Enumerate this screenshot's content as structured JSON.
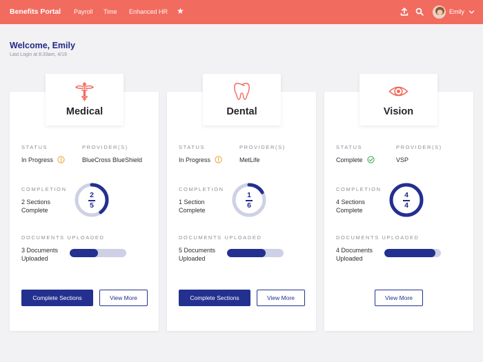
{
  "header": {
    "brand": "Benefits Portal",
    "nav": [
      "Payroll",
      "Time",
      "Enhanced HR"
    ],
    "icons": [
      "star-icon",
      "upload-icon",
      "search-icon"
    ],
    "user_name": "Emily",
    "colors": {
      "bar": "#f26b5f",
      "text": "#ffffff"
    }
  },
  "welcome": {
    "title": "Welcome, Emily",
    "last_login": "Last Login at 8:33am, 4/19"
  },
  "labels": {
    "status": "STATUS",
    "providers": "PROVIDER(S)",
    "completion": "COMPLETION",
    "documents": "DOCUMENTS UPLOADED"
  },
  "colors": {
    "accent": "#23308f",
    "ring_track": "#ced1e6",
    "in_progress": "#f0a43c",
    "complete": "#3fae5a",
    "icon": "#f26b5f"
  },
  "cards": [
    {
      "name": "Medical",
      "icon": "caduceus-icon",
      "status": "In Progress",
      "status_icon": "info-icon",
      "provider": "BlueCross BlueShield",
      "completion_text_1": "2 Sections",
      "completion_text_2": "Complete",
      "completed": "2",
      "total": "5",
      "completed_fraction": 0.4,
      "documents_text_1": "3 Documents",
      "documents_text_2": "Uploaded",
      "documents_fraction": 0.5,
      "primary_button": "Complete Sections",
      "secondary_button": "View More"
    },
    {
      "name": "Dental",
      "icon": "tooth-icon",
      "status": "In Progress",
      "status_icon": "info-icon",
      "provider": "MetLife",
      "completion_text_1": "1 Section",
      "completion_text_2": "Complete",
      "completed": "1",
      "total": "6",
      "completed_fraction": 0.1667,
      "documents_text_1": "5 Documents",
      "documents_text_2": "Uploaded",
      "documents_fraction": 0.68,
      "primary_button": "Complete Sections",
      "secondary_button": "View More"
    },
    {
      "name": "Vision",
      "icon": "eye-icon",
      "status": "Complete",
      "status_icon": "check-circle-icon",
      "provider": "VSP",
      "completion_text_1": "4 Sections",
      "completion_text_2": "Complete",
      "completed": "4",
      "total": "4",
      "completed_fraction": 1,
      "documents_text_1": "4 Documents",
      "documents_text_2": "Uploaded",
      "documents_fraction": 0.9,
      "secondary_button": "View More"
    }
  ]
}
